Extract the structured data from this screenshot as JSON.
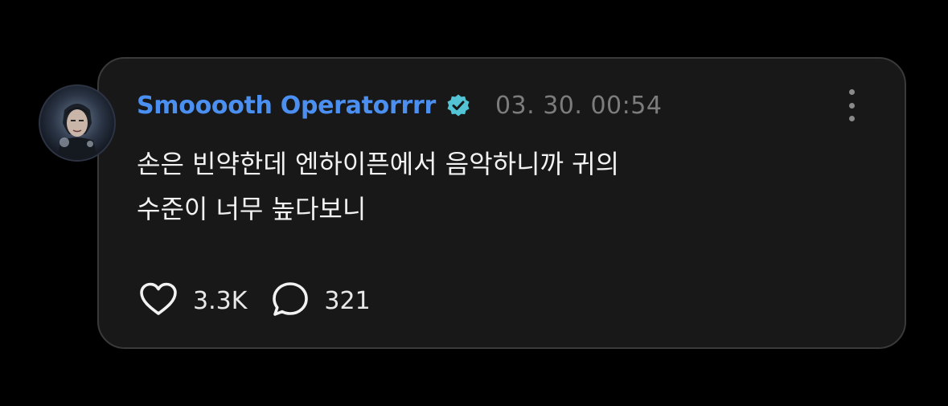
{
  "post": {
    "author": "Smooooth Operatorrrr",
    "verified": true,
    "timestamp": "03. 30. 00:54",
    "text_lines": [
      "손은 빈약한데 엔하이픈에서 음악하니까 귀의",
      "수준이 너무 높다보니"
    ],
    "likes": "3.3K",
    "comments": "321"
  },
  "icons": {
    "verified": "verified-badge-icon",
    "more": "more-vertical-icon",
    "like": "heart-icon",
    "comment": "comment-bubble-icon"
  },
  "colors": {
    "background": "#000000",
    "card": "#181818",
    "card_border": "#3a3a3a",
    "username": "#4b8ff0",
    "verified_badge": "#52c4d6",
    "timestamp": "#7c7c7c",
    "text": "#f2f2f2"
  }
}
